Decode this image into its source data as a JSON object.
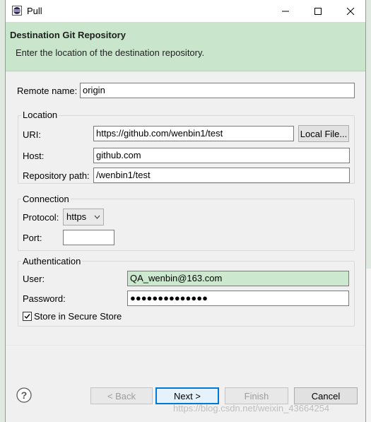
{
  "window": {
    "title": "Pull"
  },
  "header": {
    "title": "Destination Git Repository",
    "description": "Enter the location of the destination repository."
  },
  "remote": {
    "label": "Remote name:",
    "value": "origin"
  },
  "location": {
    "legend": "Location",
    "uri_label": "URI:",
    "uri_value": "https://github.com/wenbin1/test",
    "local_file_button": "Local File...",
    "host_label": "Host:",
    "host_value": "github.com",
    "repo_path_label": "Repository path:",
    "repo_path_value": "/wenbin1/test"
  },
  "connection": {
    "legend": "Connection",
    "protocol_label": "Protocol:",
    "protocol_value": "https",
    "port_label": "Port:",
    "port_value": ""
  },
  "authentication": {
    "legend": "Authentication",
    "user_label": "User:",
    "user_value": "QA_wenbin@163.com",
    "password_label": "Password:",
    "password_value": "●●●●●●●●●●●●●●",
    "store_label": "Store in Secure Store",
    "store_checked": true
  },
  "footer": {
    "back": "< Back",
    "next": "Next >",
    "finish": "Finish",
    "cancel": "Cancel"
  },
  "watermark": "https://blog.csdn.net/weixin_43664254",
  "colors": {
    "header_bg": "#c9e6cc",
    "selection": "#cce8cf",
    "accent": "#0078d7"
  }
}
